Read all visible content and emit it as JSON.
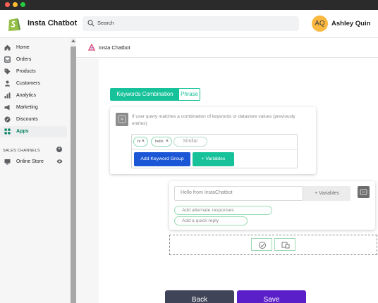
{
  "window": {
    "title": ""
  },
  "topbar": {
    "app_name": "Insta Chatbot",
    "search_placeholder": "Search",
    "user_initials": "AQ",
    "user_name": "Ashley Quin",
    "avatar_color": "#fcb940"
  },
  "sidebar": {
    "items": [
      {
        "label": "Home",
        "icon": "home-icon"
      },
      {
        "label": "Orders",
        "icon": "orders-icon"
      },
      {
        "label": "Products",
        "icon": "tag-icon"
      },
      {
        "label": "Customers",
        "icon": "person-icon"
      },
      {
        "label": "Analytics",
        "icon": "chart-icon"
      },
      {
        "label": "Marketing",
        "icon": "megaphone-icon"
      },
      {
        "label": "Discounts",
        "icon": "discount-icon"
      },
      {
        "label": "Apps",
        "icon": "apps-icon",
        "active": true
      }
    ],
    "sales_channels_title": "SALES CHANNELS",
    "channels": [
      {
        "label": "Online Store",
        "icon": "store-icon"
      }
    ]
  },
  "breadcrumb": {
    "label": "Insta Chatbot"
  },
  "editor": {
    "toggle": {
      "option_a": "Keywords Combination",
      "option_b": "Phrase",
      "selected": "Keywords Combination"
    },
    "keyword_hint": "If user query matches a combination of keywords or datastore values (previously entries)",
    "tags": [
      {
        "text": "hi"
      },
      {
        "text": "hello"
      }
    ],
    "similar_label": "Similar",
    "add_keyword_group_label": "Add Keyword Group",
    "variables_label": "+ Variables",
    "response": {
      "value": "Hello from InstaChatbot",
      "variables_label": "+ Variables",
      "add_alternate": "Add alternate responses",
      "add_quick_reply": "Add a quick reply"
    }
  },
  "actions": {
    "back": "Back",
    "save": "Save"
  },
  "colors": {
    "accent_green": "#17c29b",
    "primary_blue": "#1a56d6",
    "save_purple": "#5b1fc9",
    "back_dark": "#3f4458"
  }
}
